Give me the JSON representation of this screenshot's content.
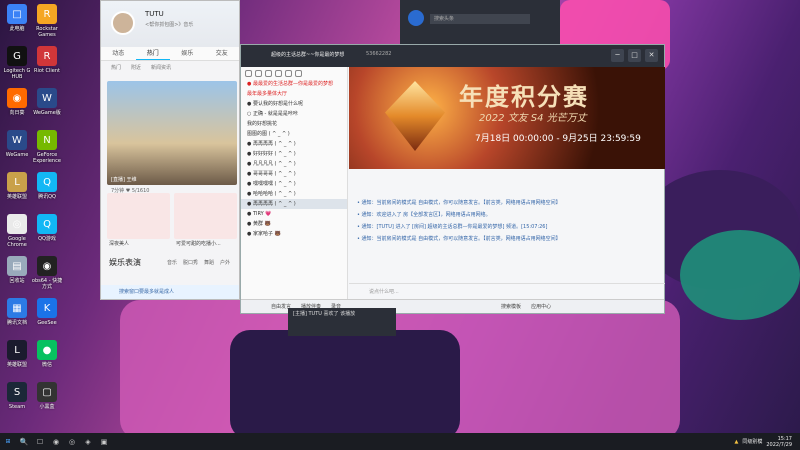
{
  "desktop": {
    "icons": [
      {
        "label": "此电脑",
        "color": "#3b82f6",
        "glyph": "□"
      },
      {
        "label": "Logitech G HUB",
        "color": "#111",
        "glyph": "G"
      },
      {
        "label": "向日葵",
        "color": "#ff6a00",
        "glyph": "◉"
      },
      {
        "label": "WeGame",
        "color": "#2a4a8a",
        "glyph": "W"
      },
      {
        "label": "英雄联盟",
        "color": "#c9a14a",
        "glyph": "L"
      },
      {
        "label": "Google Chrome",
        "color": "#eaeaea",
        "glyph": "◎"
      },
      {
        "label": "回收站",
        "color": "#9ab",
        "glyph": "▤"
      },
      {
        "label": "腾讯文档",
        "color": "#2c7be5",
        "glyph": "▦"
      },
      {
        "label": "英雄联盟",
        "color": "#1b1b2e",
        "glyph": "L"
      },
      {
        "label": "Steam",
        "color": "#1b2838",
        "glyph": "S"
      }
    ],
    "icons2": [
      {
        "label": "Rockstar Games",
        "color": "#f5a623",
        "glyph": "R"
      },
      {
        "label": "Riot Client",
        "color": "#d13639",
        "glyph": "R"
      },
      {
        "label": "WeGame版",
        "color": "#2a4a8a",
        "glyph": "W"
      },
      {
        "label": "GeForce Experience",
        "color": "#76b900",
        "glyph": "N"
      },
      {
        "label": "腾讯QQ",
        "color": "#12b7f5",
        "glyph": "Q"
      },
      {
        "label": "QQ游戏",
        "color": "#12b7f5",
        "glyph": "Q"
      },
      {
        "label": "obs64 - 快捷方式",
        "color": "#222",
        "glyph": "◉"
      },
      {
        "label": "GeeSee",
        "color": "#1a73e8",
        "glyph": "K"
      },
      {
        "label": "微信",
        "color": "#07c160",
        "glyph": "●"
      },
      {
        "label": "小黑盒",
        "color": "#333",
        "glyph": "▢"
      }
    ]
  },
  "qq": {
    "name": "TUTU",
    "signature": "<帮你抓包图>》音乐",
    "tabs": [
      "动态",
      "热门",
      "娱乐",
      "交友"
    ],
    "active_tab": "热门",
    "subtabs": [
      "热门",
      "附近",
      "新闻资讯"
    ],
    "feed_caption": "[直播] 王维",
    "feed_stats": "7分钟   ♥ 5/1610",
    "cards": [
      "深夜美人",
      "可爱可甜的吃播小..."
    ],
    "section_title": "娱乐表演",
    "section_tabs": [
      "音乐",
      "脱口秀",
      "舞蹈",
      "户外"
    ],
    "search_tip": "搜索窗口要最多就是成人"
  },
  "chat": {
    "title": "超级的主话总群~~你是最的梦想",
    "number": "53662282",
    "ctl": [
      "─",
      "□",
      "✕"
    ],
    "group_items": [
      {
        "t": "● 最最爱的生活总群—你是最爱的梦想",
        "c": "red"
      },
      {
        "t": "最年最多量体大厅",
        "c": "red"
      },
      {
        "t": "● 要认我的好想是什么呢"
      },
      {
        "t": "○ 正确 - 就是是是咔咔"
      },
      {
        "t": "我的好想挑花"
      },
      {
        "t": "图图的图 ( ^ _ ^ )"
      },
      {
        "t": "● 再再再再 ( ^ _ ^ )"
      },
      {
        "t": "● 好好好好 ( ^ _ ^ )"
      },
      {
        "t": "● 凡凡凡凡 ( ^ _ ^ )"
      },
      {
        "t": "● 哥哥哥哥 ( ^ _ ^ )"
      },
      {
        "t": "● 嘿嘿嘿嘿 ( ^ _ ^ )"
      },
      {
        "t": "● 哈哈哈哈 ( ^ _ ^ )"
      },
      {
        "t": "● 再再再再 ( ^ _ ^ )",
        "sel": true
      },
      {
        "t": "● TIRY 💗"
      },
      {
        "t": "● 黄群 🐻"
      },
      {
        "t": "● 家家哈子 🐻"
      }
    ],
    "banner": {
      "title": "年度积分赛",
      "subtitle": "2022 文友 S4 光芒万丈",
      "date": "7月18日 00:00:00 - 9月25日 23:59:59"
    },
    "messages": [
      "• 通知：当前房间的模式是 自由模式，你可以随意发言。【前言类，网络用语占用网络空间】",
      "• 通知：欢迎进入了 房【全部发言区】，网络用语占用网络。",
      "• 通知：[TUTU] 进入了 [房间] 超级的主话总群—你是最爱的梦想] 频道。[15:07:26]",
      "• 通知：当前房间的模式是 自由模式，你可以随意发言。【前言类，网络用语占用网络空间】"
    ],
    "input_placeholder": "说点什么吧...",
    "footer": [
      "自由发言",
      "播放伴奏",
      "录音",
      "搜索模板",
      "应用中心"
    ]
  },
  "float_tip": "[主播] TUTU 喜欢了 该播放",
  "browser": {
    "search": "搜索头条"
  },
  "taskbar": {
    "icons": [
      "⊞",
      "🔍",
      "☐",
      "◉",
      "◎",
      "◈",
      "▣"
    ],
    "tray_text": "同级别模",
    "time": "15:17",
    "date": "2022/7/29"
  }
}
